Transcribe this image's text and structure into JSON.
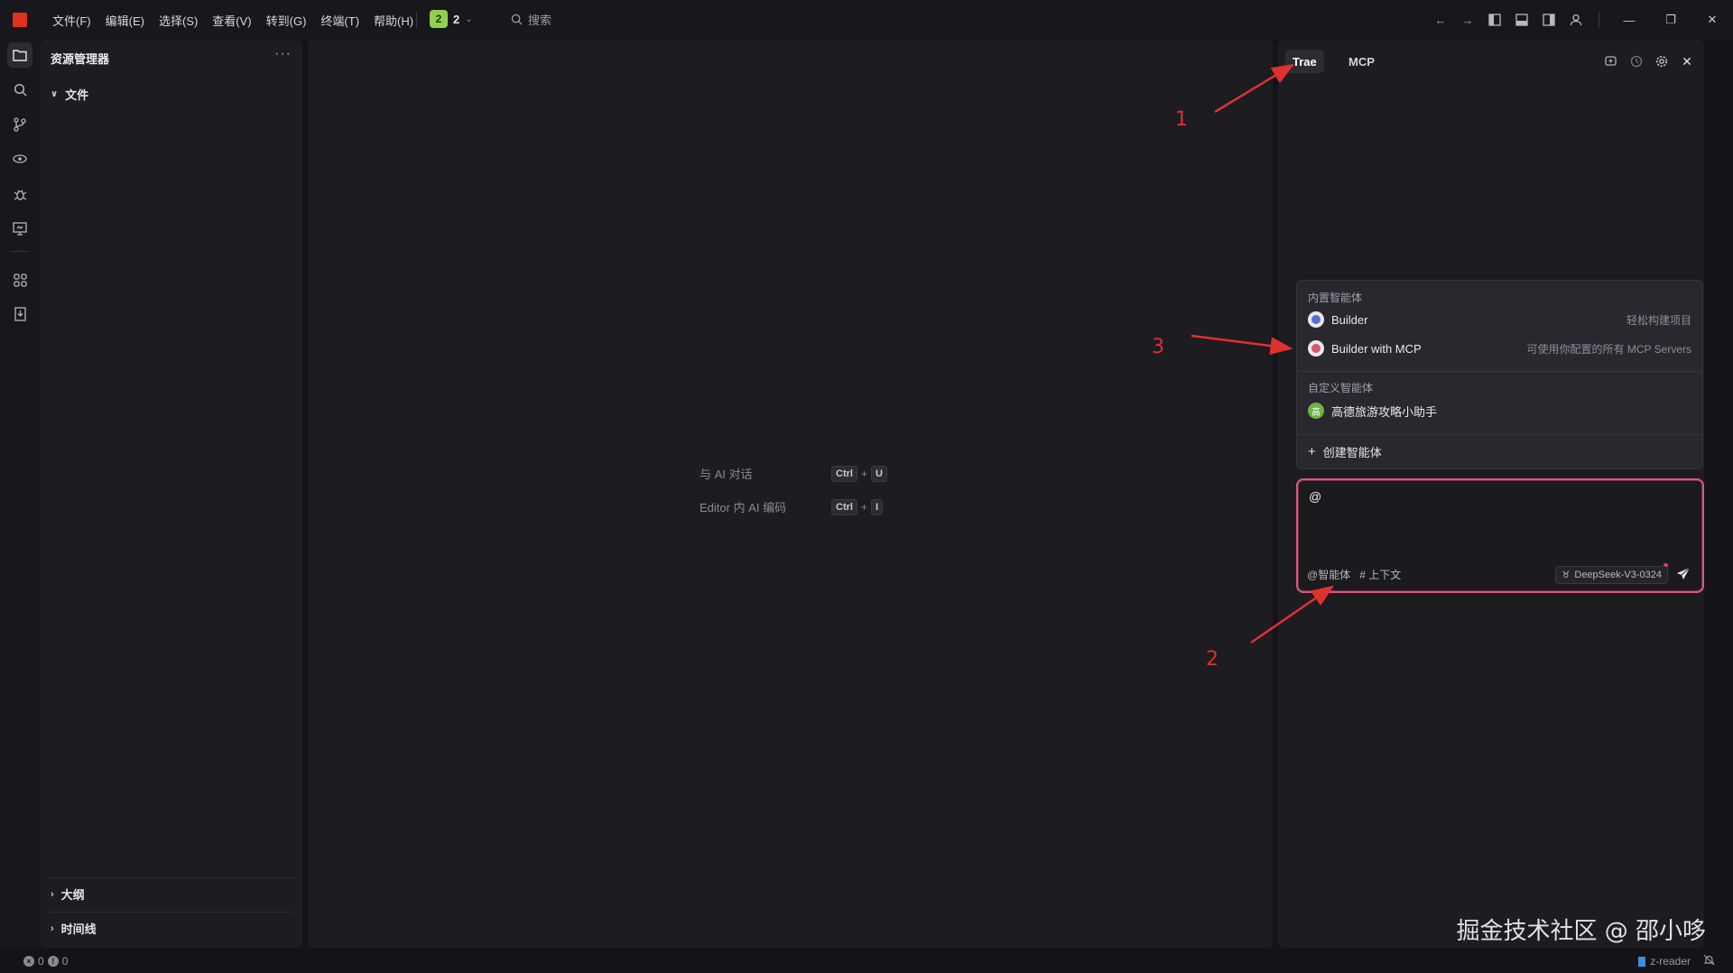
{
  "menu": [
    "文件(F)",
    "编辑(E)",
    "选择(S)",
    "查看(V)",
    "转到(G)",
    "终端(T)",
    "帮助(H)"
  ],
  "project_badge": {
    "number": "2",
    "count": "2"
  },
  "search": {
    "label": "搜索"
  },
  "sidebar": {
    "title": "资源管理器",
    "more": "···",
    "files_section": "文件",
    "outline_section": "大纲",
    "timeline_section": "时间线"
  },
  "editor": {
    "hints": [
      {
        "label": "与 AI 对话",
        "key1": "Ctrl",
        "key2": "U"
      },
      {
        "label": "Editor 内 AI 编码",
        "key1": "Ctrl",
        "key2": "I"
      }
    ]
  },
  "right_panel": {
    "tabs": [
      "Trae",
      "MCP"
    ]
  },
  "agent_menu": {
    "builtin_group": "内置智能体",
    "builtin": [
      {
        "name": "Builder",
        "desc": "轻松构建项目",
        "color": "#5b6bd9"
      },
      {
        "name": "Builder with MCP",
        "desc": "可使用你配置的所有 MCP Servers",
        "color": "#d9566b"
      }
    ],
    "custom_group": "自定义智能体",
    "custom": [
      {
        "name": "高德旅游攻略小助手",
        "avatar": "高",
        "color": "#6fb342"
      }
    ],
    "create_label": "创建智能体"
  },
  "chat": {
    "input_value": "@",
    "agent_tool": "智能体",
    "context_tool": "上下文",
    "model": "DeepSeek-V3-0324"
  },
  "annotations": [
    "1",
    "2",
    "3"
  ],
  "watermark": "掘金技术社区 @ 邵小哆",
  "status": {
    "errors": "0",
    "warnings": "0",
    "extension": "z-reader"
  },
  "colors": {
    "accent_border": "#d65a7c",
    "annotation": "#e03030",
    "badge": "#8fd14f"
  }
}
